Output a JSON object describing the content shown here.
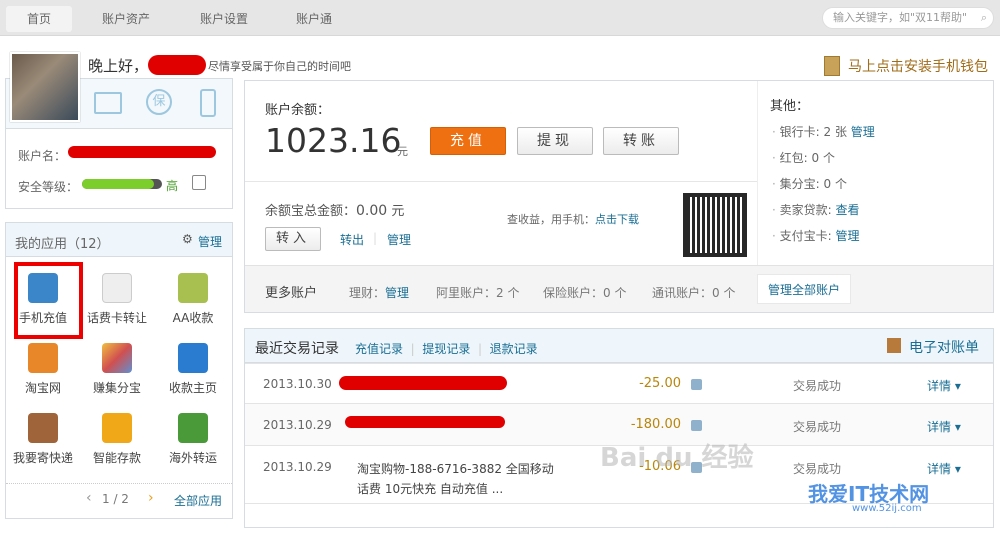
{
  "topnav": {
    "tabs": [
      "首页",
      "账户资产",
      "账户设置",
      "账户通"
    ],
    "search_placeholder": "输入关键字，如\"双11帮助\""
  },
  "greeting": {
    "hello": "晚上好，",
    "message": "尽情享受属于你自己的时间吧",
    "install_link": "马上点击安装手机钱包"
  },
  "profile": {
    "account_label": "账户名：",
    "security_label": "安全等级：",
    "security_level": "高",
    "security_fraction": 0.9
  },
  "apps": {
    "title": "我的应用（12）",
    "manage": "管理",
    "items": [
      "手机充值",
      "话费卡转让",
      "AA收款",
      "淘宝网",
      "赚集分宝",
      "收款主页",
      "我要寄快递",
      "智能存款",
      "海外转运"
    ],
    "page": "1 / 2",
    "all": "全部应用"
  },
  "balance": {
    "label": "账户余额：",
    "amount": "1023.16",
    "unit": "元",
    "recharge": "充值",
    "withdraw": "提现",
    "transfer": "转账"
  },
  "yuebao": {
    "label": "余额宝总金额：",
    "amount": "0.00",
    "unit": "元",
    "in": "转入",
    "out": "转出",
    "manage": "管理",
    "mobile_text": "查收益，用手机：",
    "download": "点击下载"
  },
  "other": {
    "title": "其他：",
    "items": [
      {
        "label": "银行卡: 2 张",
        "link": "管理"
      },
      {
        "label": "红包: 0 个",
        "link": ""
      },
      {
        "label": "集分宝: 0 个",
        "link": ""
      },
      {
        "label": "卖家贷款:",
        "link": "查看"
      },
      {
        "label": "支付宝卡:",
        "link": "管理"
      }
    ]
  },
  "more": {
    "title": "更多账户",
    "licai": "理财：",
    "licai_link": "管理",
    "ali": "阿里账户：2 个",
    "insurance": "保险账户：0 个",
    "telecom": "通讯账户：0 个",
    "manage_all": "管理全部账户"
  },
  "trans": {
    "title": "最近交易记录",
    "links": [
      "充值记录",
      "提现记录",
      "退款记录"
    ],
    "statement": "电子对账单",
    "rows": [
      {
        "date": "2013.10.30",
        "desc": "",
        "amount": "-25.00",
        "status": "交易成功",
        "detail": "详情 ▾"
      },
      {
        "date": "2013.10.29",
        "desc": "",
        "amount": "-180.00",
        "status": "交易成功",
        "detail": "详情 ▾"
      },
      {
        "date": "2013.10.29",
        "desc": "淘宝购物-188-6716-3882 全国移动",
        "desc2": "话费 10元快充 自动充值 ...",
        "amount": "-10.06",
        "status": "交易成功",
        "detail": "详情 ▾"
      }
    ]
  },
  "watermark": {
    "baidu": "Bai du 经验",
    "site": "我爱IT技术网",
    "url": "www.52ij.com"
  }
}
